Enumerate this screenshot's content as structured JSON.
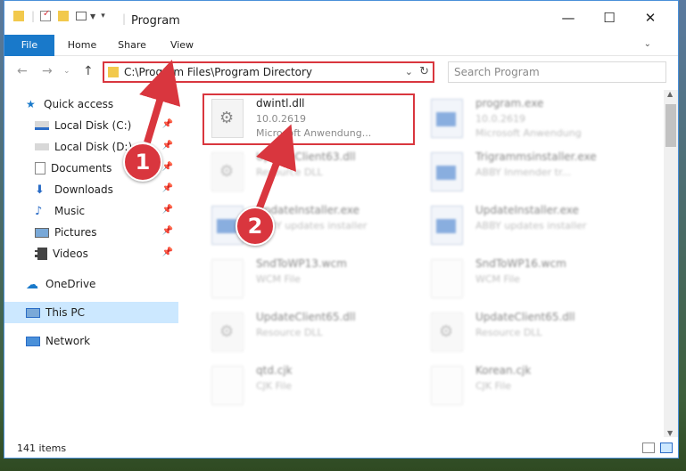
{
  "window": {
    "title": "Program"
  },
  "ribbon": {
    "file": "File",
    "home": "Home",
    "share": "Share",
    "view": "View"
  },
  "address": {
    "path": "C:\\Program Files\\Program Directory"
  },
  "search": {
    "placeholder": "Search Program"
  },
  "nav": {
    "items": [
      {
        "label": "Quick access"
      },
      {
        "label": "Local Disk (C:)"
      },
      {
        "label": "Local Disk (D:)"
      },
      {
        "label": "Documents"
      },
      {
        "label": "Downloads"
      },
      {
        "label": "Music"
      },
      {
        "label": "Pictures"
      },
      {
        "label": "Videos"
      },
      {
        "label": "OneDrive"
      },
      {
        "label": "This PC"
      },
      {
        "label": "Network"
      }
    ]
  },
  "files": [
    {
      "name": "dwintl.dll",
      "meta1": "10.0.2619",
      "meta2": "Microsoft Anwendung..."
    },
    {
      "name": "program.exe",
      "meta1": "10.0.2619",
      "meta2": "Microsoft Anwendung"
    },
    {
      "name": "UpdateClient63.dll",
      "meta1": "Resource DLL"
    },
    {
      "name": "Trigrammsinstaller.exe",
      "meta1": "ABBY Inmender tr..."
    },
    {
      "name": "UpdateInstaller.exe",
      "meta1": "ABBY updates installer"
    },
    {
      "name": "UpdateInstaller.exe",
      "meta1": "ABBY updates installer"
    },
    {
      "name": "SndToWP13.wcm",
      "meta1": "WCM File"
    },
    {
      "name": "SndToWP16.wcm",
      "meta1": "WCM File"
    },
    {
      "name": "UpdateClient65.dll",
      "meta1": "Resource DLL"
    },
    {
      "name": "UpdateClient65.dll",
      "meta1": "Resource DLL"
    },
    {
      "name": "qtd.cjk",
      "meta1": "CJK File"
    },
    {
      "name": "Korean.cjk",
      "meta1": "CJK File"
    }
  ],
  "status": {
    "count": "141 items"
  },
  "annotations": {
    "one": "1",
    "two": "2"
  },
  "colors": {
    "accent": "#1979ca",
    "highlight": "#d9363e"
  }
}
